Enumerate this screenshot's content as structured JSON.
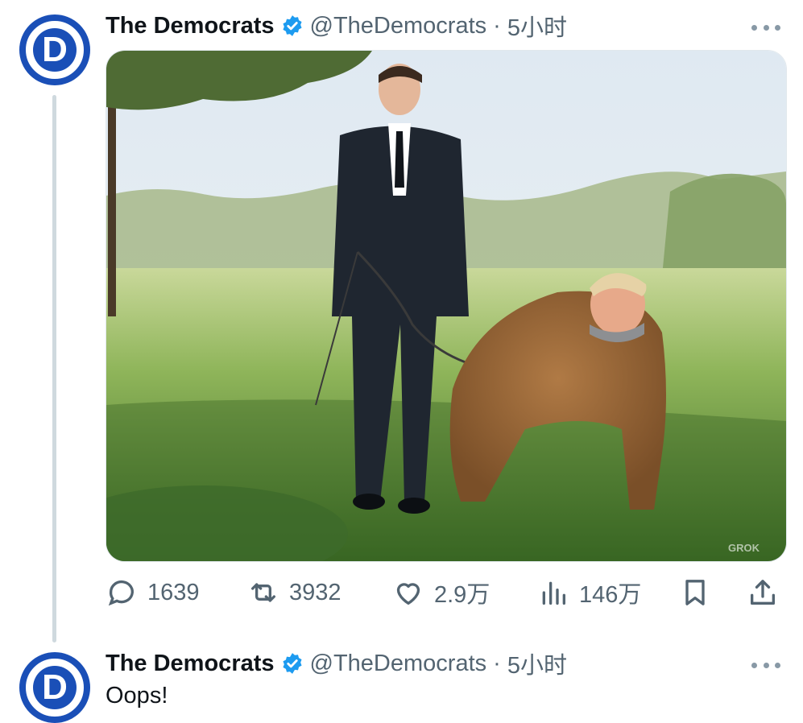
{
  "tweets": [
    {
      "author": {
        "display_name": "The Democrats",
        "handle": "@TheDemocrats",
        "avatar_letter": "D",
        "verified": true
      },
      "separator": "·",
      "time": "5小时",
      "media": {
        "watermark": "GROK"
      },
      "actions": {
        "replies": "1639",
        "retweets": "3932",
        "likes": "2.9万",
        "views": "146万"
      }
    },
    {
      "author": {
        "display_name": "The Democrats",
        "handle": "@TheDemocrats",
        "avatar_letter": "D",
        "verified": true
      },
      "separator": "·",
      "time": "5小时",
      "text": "Oops!"
    }
  ],
  "colors": {
    "brand_blue": "#1a4fb7",
    "verified_blue": "#1d9bf0",
    "muted": "#536471"
  },
  "icons": {
    "reply": "speech-bubble-icon",
    "retweet": "retweet-icon",
    "like": "heart-icon",
    "views": "bar-chart-icon",
    "bookmark": "bookmark-icon",
    "share": "share-icon",
    "more": "ellipsis-icon"
  }
}
